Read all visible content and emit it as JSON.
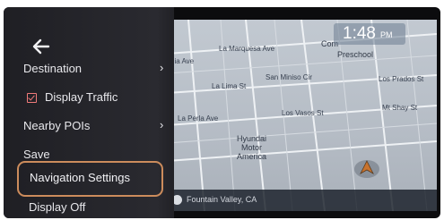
{
  "clock": {
    "time": "1:48",
    "ampm": "PM"
  },
  "location": {
    "city": "Fountain Valley, CA"
  },
  "map": {
    "streets": [
      "La Marquesa Ave",
      "hia Ave",
      "La Lima St",
      "San Miniso Cir",
      "Los Prados St",
      "La Perla Ave",
      "Los Vasos St",
      "Mt Shay St"
    ],
    "poi_school_line1": "Com",
    "poi_school_line2": "Preschool",
    "poi_dealer": "Hyundai\nMotor\nAmerica"
  },
  "menu": {
    "items": [
      {
        "label": "Destination",
        "has_chevron": true
      },
      {
        "label": "Display Traffic",
        "checked": true
      },
      {
        "label": "Nearby POIs",
        "has_chevron": true
      },
      {
        "label": "Save"
      },
      {
        "label": "Navigation Settings",
        "highlighted": true
      },
      {
        "label": "Display Off"
      }
    ]
  },
  "colors": {
    "highlight_border": "#cc8c5c",
    "menu_bg": "#242429",
    "checkbox": "#f07a7a"
  }
}
